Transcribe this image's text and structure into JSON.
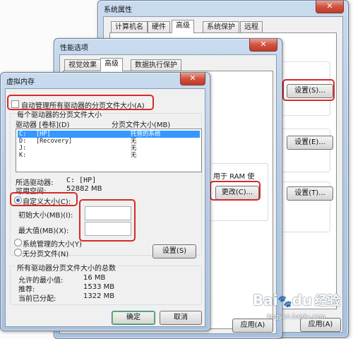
{
  "system_properties": {
    "title": "系统属性",
    "close": "✕",
    "tabs": [
      "计算机名",
      "硬件",
      "高级",
      "系统保护",
      "远程"
    ],
    "settings_buttons": [
      "设置(S)...",
      "设置(E)...",
      "设置(T)..."
    ],
    "bottom_button": "应用(A)"
  },
  "performance_options": {
    "title": "性能选项",
    "close": "✕",
    "tabs": [
      "视觉效果",
      "高级",
      "数据执行保护"
    ],
    "snippet_ram": "用于 RAM 使",
    "snippet_mb": "MB",
    "change_button": "更改(C)..."
  },
  "virtual_memory": {
    "title": "虚拟内存",
    "close": "✕",
    "auto_manage_label": "自动管理所有驱动器的分页文件大小(A)",
    "per_drive_group": "每个驱动器的分页文件大小",
    "col_drive": "驱动器 [卷标](D)",
    "col_size": "分页文件大小(MB)",
    "drives": [
      {
        "drive": "C:",
        "label": "[HP]",
        "size": "托管的系统",
        "selected": true
      },
      {
        "drive": "D:",
        "label": "[Recovery]",
        "size": "无",
        "selected": false
      },
      {
        "drive": "J:",
        "label": "",
        "size": "无",
        "selected": false
      },
      {
        "drive": "K:",
        "label": "",
        "size": "无",
        "selected": false
      }
    ],
    "selected_drive_label": "所选驱动器:",
    "selected_drive_value": "C:  [HP]",
    "available_space_label": "可用空间:",
    "available_space_value": "52882 MB",
    "custom_size_label": "自定义大小(C):",
    "initial_size_label": "初始大小(MB)(I):",
    "initial_size_value": "",
    "max_size_label": "最大值(MB)(X):",
    "max_size_value": "",
    "system_managed_label": "系统管理的大小(Y)",
    "no_paging_label": "无分页文件(N)",
    "set_button": "设置(S)",
    "total_group": "所有驱动器分页文件大小的总数",
    "min_allowed_label": "允许的最小值:",
    "min_allowed_value": "16 MB",
    "recommended_label": "推荐:",
    "recommended_value": "1533 MB",
    "current_label": "当前已分配:",
    "current_value": "1322 MB",
    "ok_button": "确定",
    "cancel_button": "取消"
  },
  "watermark": {
    "logo": "Bai",
    "paw": "du",
    "site": "经验",
    "url": "jingyan.baidu.com"
  },
  "colors": {
    "highlight_red": "#d62a2a",
    "selection_blue": "#3399ff",
    "focus_green": "#6ec34a"
  }
}
